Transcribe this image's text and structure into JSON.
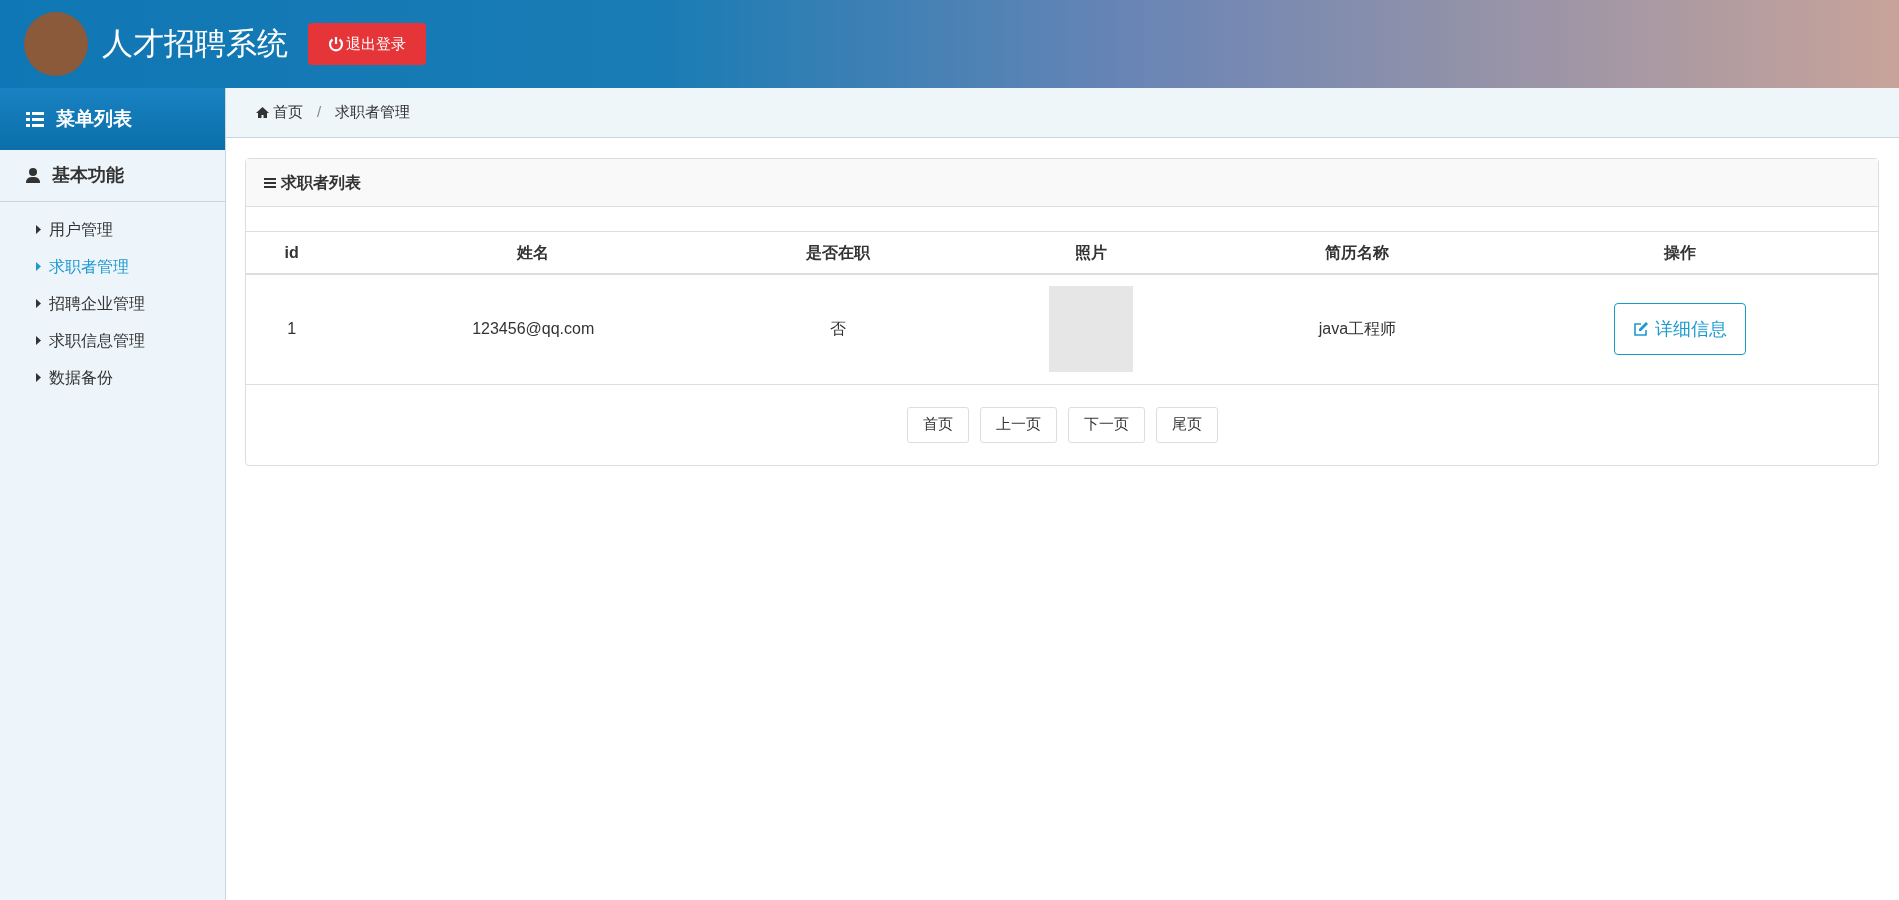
{
  "header": {
    "title": "人才招聘系统",
    "logout_button": "退出登录"
  },
  "sidebar": {
    "heading": "菜单列表",
    "section": "基本功能",
    "items": [
      {
        "label": "用户管理",
        "selected": false
      },
      {
        "label": "求职者管理",
        "selected": true
      },
      {
        "label": "招聘企业管理",
        "selected": false
      },
      {
        "label": "求职信息管理",
        "selected": false
      },
      {
        "label": "数据备份",
        "selected": false
      }
    ]
  },
  "breadcrumb": [
    "首页",
    "求职者管理"
  ],
  "breadcrumb_separator": "/",
  "panel": {
    "title": "求职者列表",
    "table": {
      "columns": [
        "id",
        "姓名",
        "是否在职",
        "照片",
        "简历名称",
        "操作"
      ],
      "rows": [
        {
          "id": "1",
          "name": "123456@qq.com",
          "employed": "否",
          "resume": "java工程师",
          "action": "详细信息"
        }
      ]
    },
    "pagination": [
      "首页",
      "上一页",
      "下一页",
      "尾页"
    ]
  }
}
